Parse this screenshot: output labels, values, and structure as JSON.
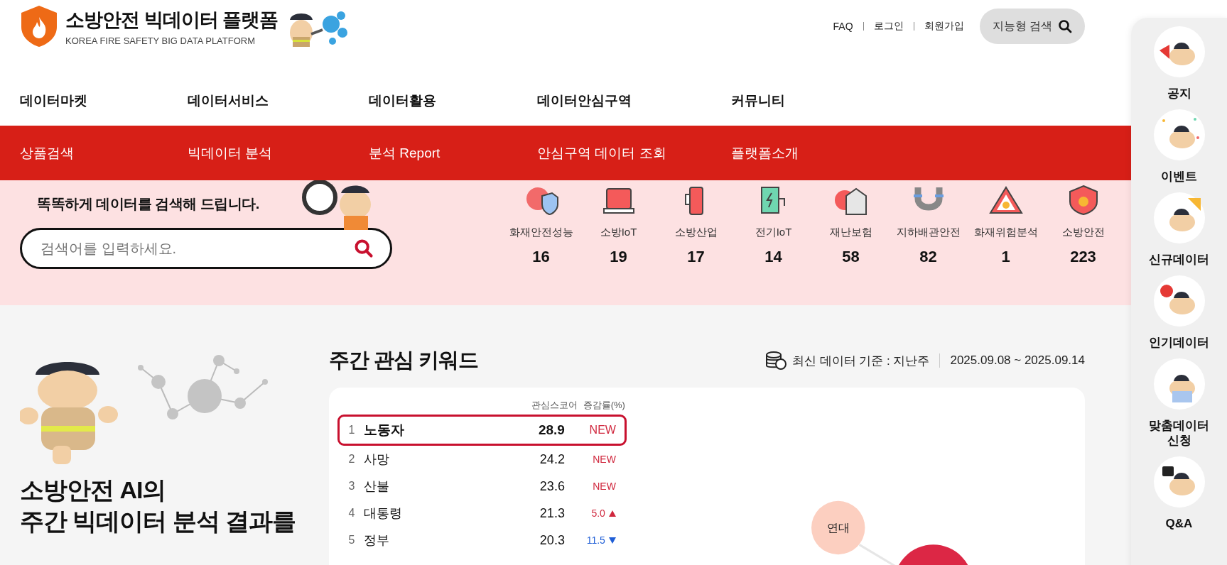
{
  "header": {
    "logo": {
      "title": "소방안전 빅데이터 플랫폼",
      "subtitle": "KOREA FIRE SAFETY BIG DATA PLATFORM"
    },
    "links": [
      "FAQ",
      "로그인",
      "회원가입"
    ],
    "search_button": "지능형 검색"
  },
  "nav": [
    {
      "label": "데이터마켓",
      "submenu": "상품검색"
    },
    {
      "label": "데이터서비스",
      "submenu": "빅데이터 분석"
    },
    {
      "label": "데이터활용",
      "submenu": "분석 Report"
    },
    {
      "label": "데이터안심구역",
      "submenu": "안심구역 데이터 조회"
    },
    {
      "label": "커뮤니티",
      "submenu": "플랫폼소개"
    }
  ],
  "search_panel": {
    "tagline": "똑똑하게 데이터를 검색해 드립니다.",
    "placeholder": "검색어를 입력하세요."
  },
  "categories": [
    {
      "kind": "shield",
      "label": "화재안전성능",
      "count": "16"
    },
    {
      "kind": "alarm",
      "label": "소방IoT",
      "count": "19"
    },
    {
      "kind": "extinguisher",
      "label": "소방산업",
      "count": "17"
    },
    {
      "kind": "charger",
      "label": "전기IoT",
      "count": "14"
    },
    {
      "kind": "house",
      "label": "재난보험",
      "count": "58"
    },
    {
      "kind": "pipe",
      "label": "지하배관안전",
      "count": "82"
    },
    {
      "kind": "warning",
      "label": "화재위험분석",
      "count": "1"
    },
    {
      "kind": "flame",
      "label": "소방안전",
      "count": "223"
    }
  ],
  "promo": {
    "title": "소방안전 AI의",
    "subtitle": "주간 빅데이터 분석 결과를"
  },
  "keywords": {
    "title": "주간 관심 키워드",
    "basis": "최신 데이터 기준 : 지난주",
    "period": "2025.09.08 ~ 2025.09.14",
    "columns": [
      "관심스코어",
      "증감률(%)"
    ],
    "rows": [
      {
        "rank": "1",
        "keyword": "노동자",
        "score": "28.9",
        "change": "NEW",
        "kind": "new",
        "selected": true
      },
      {
        "rank": "2",
        "keyword": "사망",
        "score": "24.2",
        "change": "NEW",
        "kind": "new",
        "selected": false
      },
      {
        "rank": "3",
        "keyword": "산불",
        "score": "23.6",
        "change": "NEW",
        "kind": "new",
        "selected": false
      },
      {
        "rank": "4",
        "keyword": "대통령",
        "score": "21.3",
        "change": "5.0",
        "kind": "up",
        "selected": false
      },
      {
        "rank": "5",
        "keyword": "정부",
        "score": "20.3",
        "change": "11.5",
        "kind": "down",
        "selected": false
      }
    ],
    "bubbles": [
      {
        "label": "연대"
      }
    ]
  },
  "quick_menu": [
    {
      "label": "공지",
      "kind": "megaphone"
    },
    {
      "label": "이벤트",
      "kind": "confetti"
    },
    {
      "label": "신규데이터",
      "kind": "new"
    },
    {
      "label": "인기데이터",
      "kind": "star"
    },
    {
      "label": "맞춤데이터 신청",
      "kind": "laptop"
    },
    {
      "label": "Q&A",
      "kind": "question"
    }
  ]
}
